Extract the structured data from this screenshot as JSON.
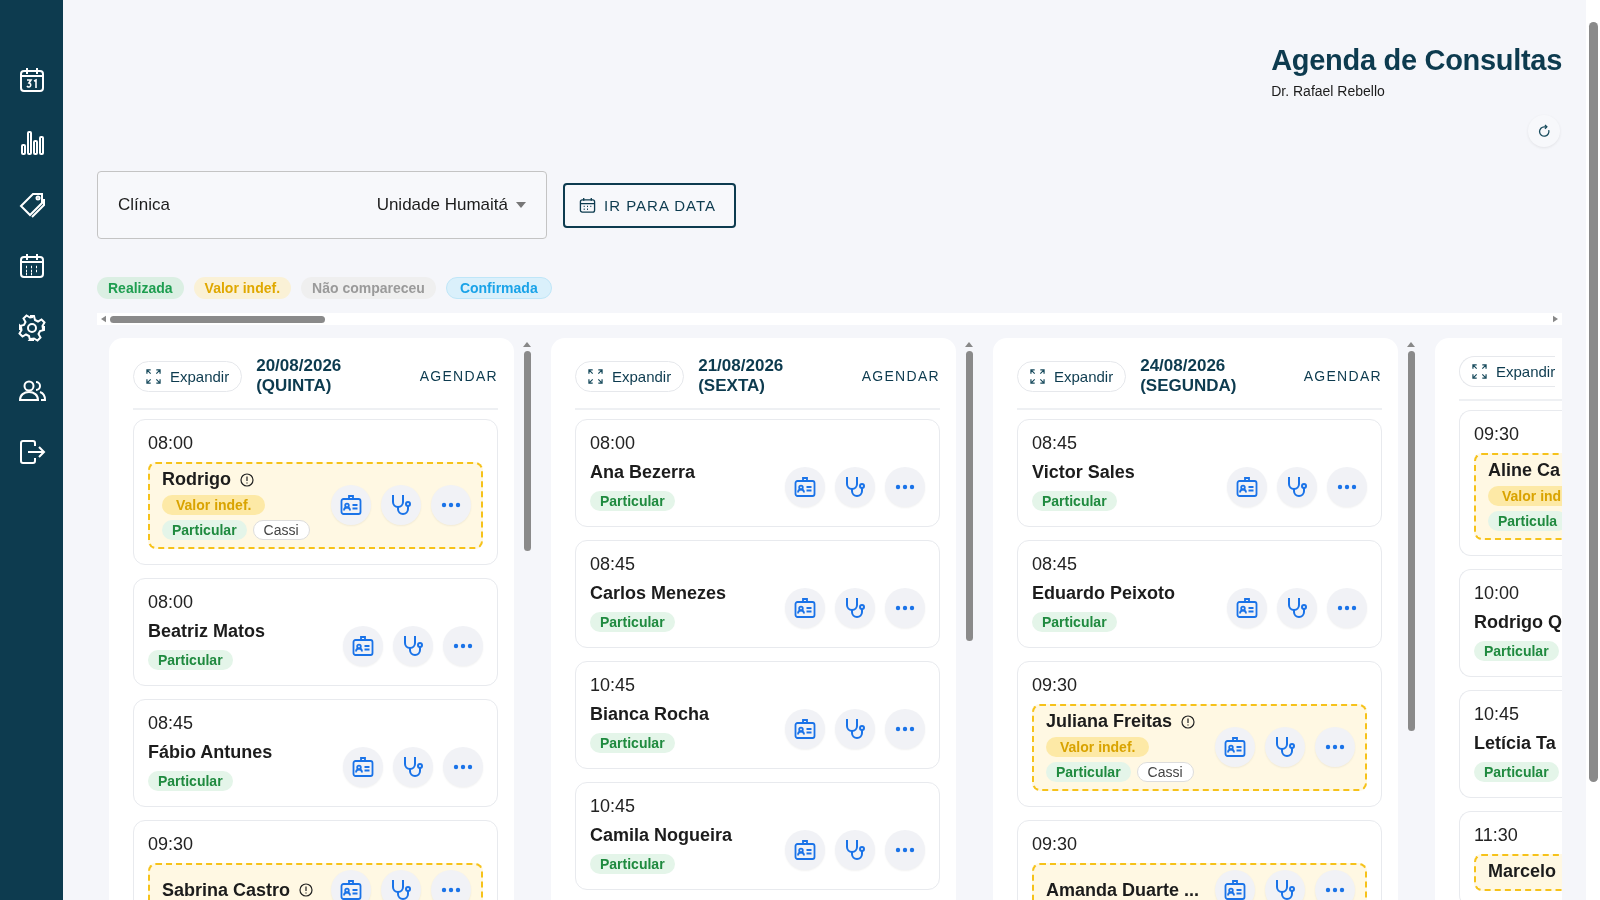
{
  "header": {
    "title": "Agenda de Consultas",
    "subtitle": "Dr. Rafael Rebello"
  },
  "clinic": {
    "label": "Clínica",
    "value": "Unidade Humaitá"
  },
  "goto_button": "IR PARA DATA",
  "legend": [
    {
      "label": "Realizada",
      "color": "#1e9e50"
    },
    {
      "label": "Valor indef.",
      "color": "#e0a800"
    },
    {
      "label": "Não compareceu",
      "color": "#9a9a9a"
    },
    {
      "label": "Confirmada",
      "color": "#1aa3e8"
    }
  ],
  "days": [
    {
      "expand": "Expandir",
      "date": "20/08/2026",
      "weekday": "(QUINTA)",
      "action": "AGENDAR",
      "appointments": [
        {
          "time": "08:00",
          "name": "Rodrigo",
          "warning": true,
          "info": true,
          "status": "Valor indef.",
          "tags": [
            {
              "label": "Particular",
              "kind": "plan"
            },
            {
              "label": "Cassi",
              "kind": "insurer"
            }
          ]
        },
        {
          "time": "08:00",
          "name": "Beatriz Matos",
          "warning": false,
          "tags": [
            {
              "label": "Particular",
              "kind": "plan"
            }
          ]
        },
        {
          "time": "08:45",
          "name": "Fábio Antunes",
          "warning": false,
          "tags": [
            {
              "label": "Particular",
              "kind": "plan"
            }
          ]
        },
        {
          "time": "09:30",
          "name": "Sabrina Castro",
          "warning": true,
          "info": true
        }
      ]
    },
    {
      "expand": "Expandir",
      "date": "21/08/2026",
      "weekday": "(SEXTA)",
      "action": "AGENDAR",
      "appointments": [
        {
          "time": "08:00",
          "name": "Ana Bezerra",
          "warning": false,
          "tags": [
            {
              "label": "Particular",
              "kind": "plan"
            }
          ]
        },
        {
          "time": "08:45",
          "name": "Carlos Menezes",
          "warning": false,
          "tags": [
            {
              "label": "Particular",
              "kind": "plan"
            }
          ]
        },
        {
          "time": "10:45",
          "name": "Bianca Rocha",
          "warning": false,
          "tags": [
            {
              "label": "Particular",
              "kind": "plan"
            }
          ]
        },
        {
          "time": "10:45",
          "name": "Camila Nogueira",
          "warning": false,
          "tags": [
            {
              "label": "Particular",
              "kind": "plan"
            }
          ]
        }
      ]
    },
    {
      "expand": "Expandir",
      "date": "24/08/2026",
      "weekday": "(SEGUNDA)",
      "action": "AGENDAR",
      "appointments": [
        {
          "time": "08:45",
          "name": "Victor Sales",
          "warning": false,
          "tags": [
            {
              "label": "Particular",
              "kind": "plan"
            }
          ]
        },
        {
          "time": "08:45",
          "name": "Eduardo Peixoto",
          "warning": false,
          "tags": [
            {
              "label": "Particular",
              "kind": "plan"
            }
          ]
        },
        {
          "time": "09:30",
          "name": "Juliana Freitas",
          "warning": true,
          "info": true,
          "status": "Valor indef.",
          "tags": [
            {
              "label": "Particular",
              "kind": "plan"
            },
            {
              "label": "Cassi",
              "kind": "insurer"
            }
          ]
        },
        {
          "time": "09:30",
          "name": "Amanda Duarte ...",
          "warning": true
        }
      ]
    },
    {
      "expand": "Expandir",
      "appointments": [
        {
          "time": "09:30",
          "name": "Aline Ca",
          "warning": true,
          "status": "Valor ind",
          "tags": [
            {
              "label": "Particula",
              "kind": "plan"
            }
          ]
        },
        {
          "time": "10:00",
          "name": "Rodrigo Q",
          "warning": false,
          "tags": [
            {
              "label": "Particular",
              "kind": "plan"
            }
          ]
        },
        {
          "time": "10:45",
          "name": "Letícia Ta",
          "warning": false,
          "tags": [
            {
              "label": "Particular",
              "kind": "plan"
            }
          ]
        },
        {
          "time": "11:30",
          "name": "Marcelo",
          "warning": true
        }
      ]
    }
  ]
}
